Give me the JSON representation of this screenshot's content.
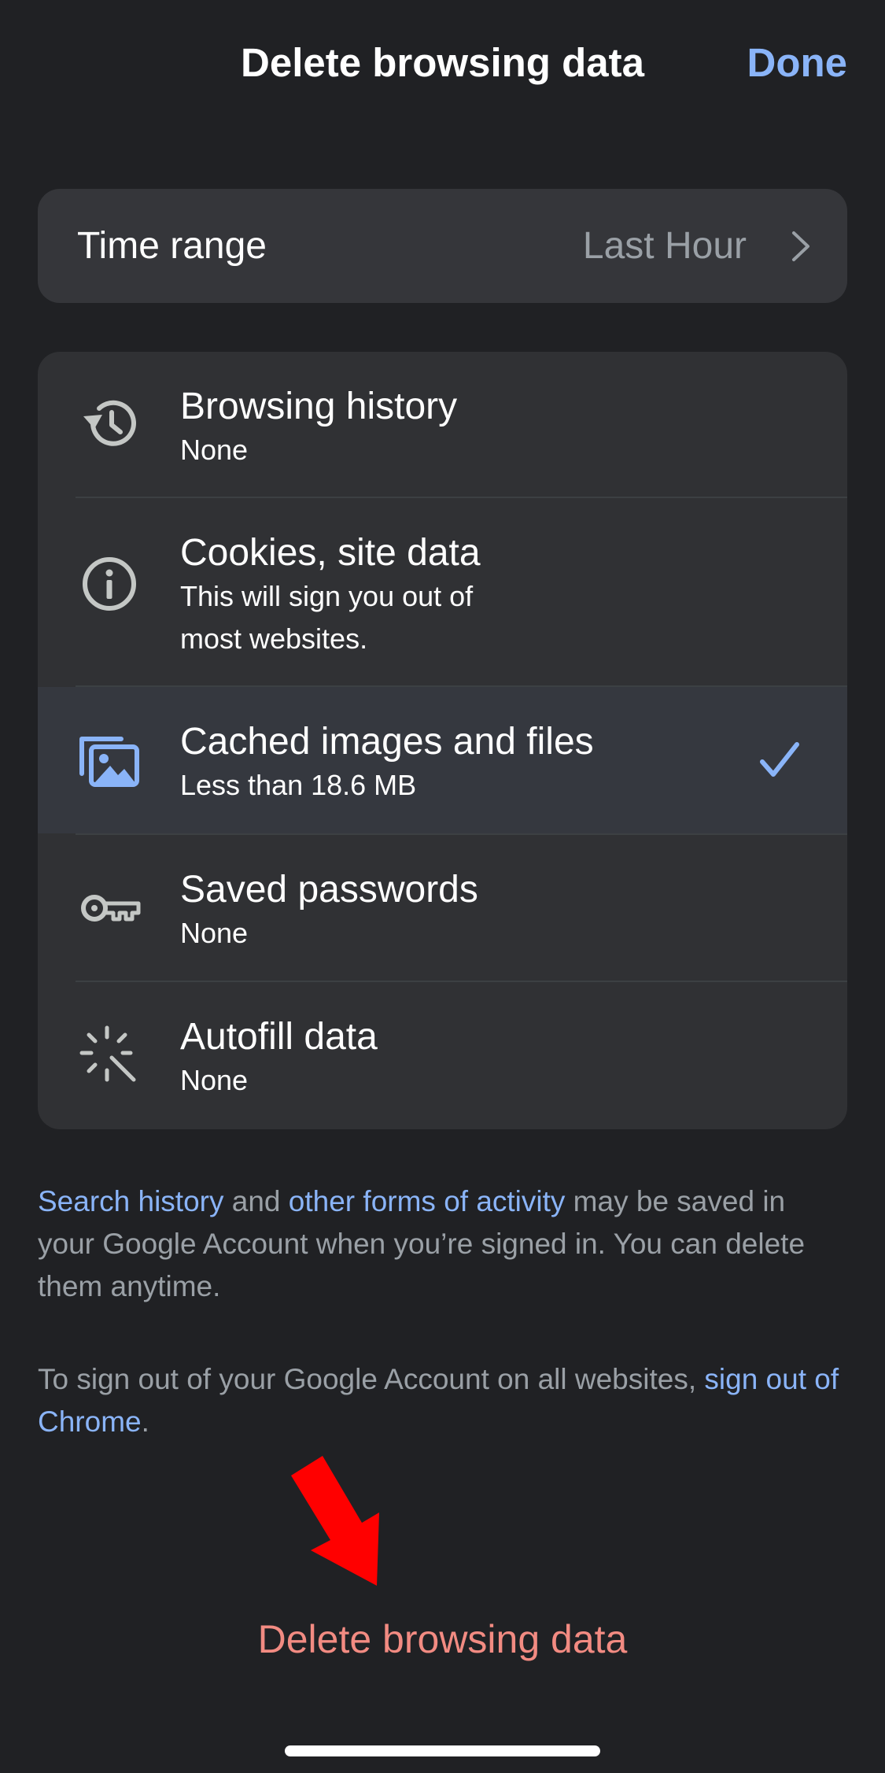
{
  "nav": {
    "title": "Delete browsing data",
    "done_label": "Done"
  },
  "time_range": {
    "label": "Time range",
    "value": "Last Hour"
  },
  "data_types": [
    {
      "icon": "history-icon",
      "title": "Browsing history",
      "subtitle_lines": [
        "None"
      ],
      "checked": false
    },
    {
      "icon": "info-icon",
      "title": "Cookies, site data",
      "subtitle_lines": [
        "This will sign you out of",
        "most websites."
      ],
      "checked": false
    },
    {
      "icon": "images-icon",
      "title": "Cached images and files",
      "subtitle_lines": [
        "Less than 18.6 MB"
      ],
      "checked": true
    },
    {
      "icon": "key-icon",
      "title": "Saved passwords",
      "subtitle_lines": [
        "None"
      ],
      "checked": false
    },
    {
      "icon": "magic-wand-icon",
      "title": "Autofill data",
      "subtitle_lines": [
        "None"
      ],
      "checked": false
    }
  ],
  "info": {
    "search_history_link": "Search history",
    "and_text": " and ",
    "other_activity_link": "other forms of activity",
    "saved_text": " may be saved in your Google Account when you’re signed in. You can delete them anytime.",
    "signout_prefix": "To sign out of your Google Account on all websites, ",
    "signout_link": "sign out of Chrome",
    "signout_suffix": "."
  },
  "delete_button_label": "Delete browsing data",
  "colors": {
    "background": "#202124",
    "card": "#303134",
    "link": "#8ab4f8",
    "destructive": "#f28b82",
    "annotation": "#ff0000"
  }
}
